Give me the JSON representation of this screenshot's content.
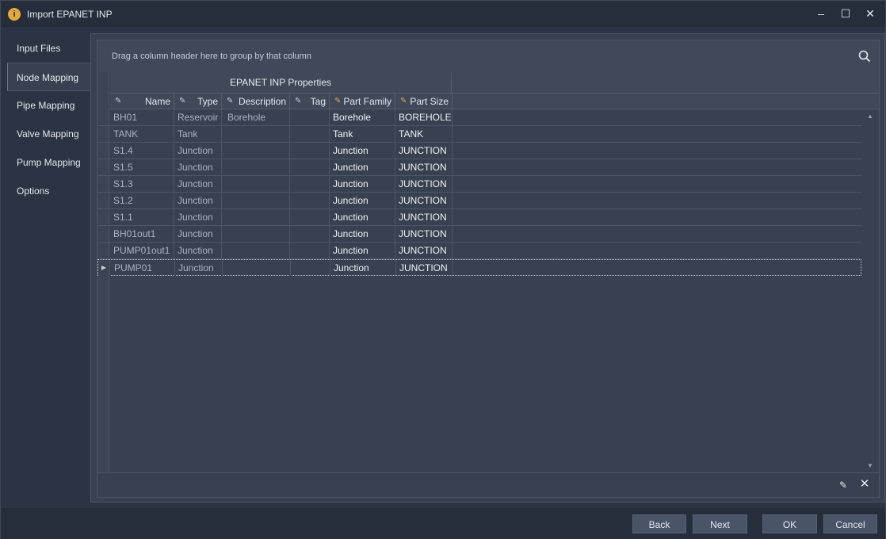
{
  "window": {
    "title": "Import EPANET INP"
  },
  "sidebar": {
    "items": [
      {
        "label": "Input Files"
      },
      {
        "label": "Node Mapping",
        "active": true
      },
      {
        "label": "Pipe Mapping"
      },
      {
        "label": "Valve Mapping"
      },
      {
        "label": "Pump Mapping"
      },
      {
        "label": "Options"
      }
    ]
  },
  "grid": {
    "group_hint": "Drag a column header here to group by that column",
    "band_label": "EPANET INP Properties",
    "columns": [
      {
        "label": "Name",
        "pencil": "gray"
      },
      {
        "label": "Type",
        "pencil": "gray"
      },
      {
        "label": "Description",
        "pencil": "gray"
      },
      {
        "label": "Tag",
        "pencil": "gray"
      },
      {
        "label": "Part Family",
        "pencil": "orange"
      },
      {
        "label": "Part Size",
        "pencil": "orange"
      }
    ],
    "rows": [
      {
        "name": "BH01",
        "type": "Reservoir",
        "description": "Borehole",
        "tag": "",
        "part_family": "Borehole",
        "part_size": "BOREHOLE"
      },
      {
        "name": "TANK",
        "type": "Tank",
        "description": "",
        "tag": "",
        "part_family": "Tank",
        "part_size": "TANK"
      },
      {
        "name": "S1.4",
        "type": "Junction",
        "description": "",
        "tag": "",
        "part_family": "Junction",
        "part_size": "JUNCTION"
      },
      {
        "name": "S1.5",
        "type": "Junction",
        "description": "",
        "tag": "",
        "part_family": "Junction",
        "part_size": "JUNCTION"
      },
      {
        "name": "S1.3",
        "type": "Junction",
        "description": "",
        "tag": "",
        "part_family": "Junction",
        "part_size": "JUNCTION"
      },
      {
        "name": "S1.2",
        "type": "Junction",
        "description": "",
        "tag": "",
        "part_family": "Junction",
        "part_size": "JUNCTION"
      },
      {
        "name": "S1.1",
        "type": "Junction",
        "description": "",
        "tag": "",
        "part_family": "Junction",
        "part_size": "JUNCTION"
      },
      {
        "name": "BH01out1",
        "type": "Junction",
        "description": "",
        "tag": "",
        "part_family": "Junction",
        "part_size": "JUNCTION"
      },
      {
        "name": "PUMP01out1",
        "type": "Junction",
        "description": "",
        "tag": "",
        "part_family": "Junction",
        "part_size": "JUNCTION"
      },
      {
        "name": "PUMP01",
        "type": "Junction",
        "description": "",
        "tag": "",
        "part_family": "Junction",
        "part_size": "JUNCTION",
        "current": true
      }
    ]
  },
  "buttons": {
    "back": "Back",
    "next": "Next",
    "ok": "OK",
    "cancel": "Cancel"
  },
  "colors": {
    "background": "#2b3442",
    "panel": "#37414f",
    "titlebar": "#262e3b",
    "editable_accent": "#e6a15a"
  }
}
